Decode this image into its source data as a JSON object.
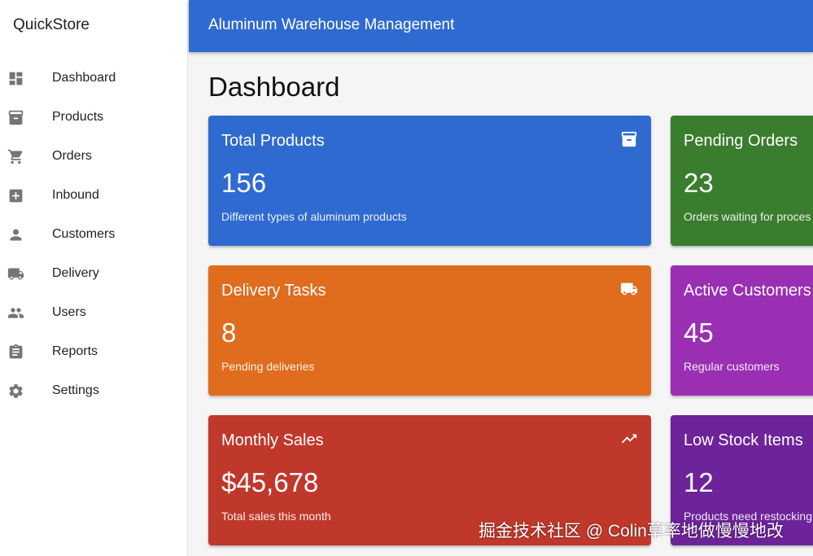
{
  "sidebar": {
    "brand": "QuickStore",
    "items": [
      {
        "label": "Dashboard",
        "icon": "dashboard-icon"
      },
      {
        "label": "Products",
        "icon": "archive-box-icon"
      },
      {
        "label": "Orders",
        "icon": "shopping-cart-icon"
      },
      {
        "label": "Inbound",
        "icon": "add-box-icon"
      },
      {
        "label": "Customers",
        "icon": "person-icon"
      },
      {
        "label": "Delivery",
        "icon": "truck-icon"
      },
      {
        "label": "Users",
        "icon": "people-icon"
      },
      {
        "label": "Reports",
        "icon": "clipboard-icon"
      },
      {
        "label": "Settings",
        "icon": "gear-icon"
      }
    ]
  },
  "appbar": {
    "title": "Aluminum Warehouse Management",
    "color": "#2f6ad0"
  },
  "page": {
    "title": "Dashboard"
  },
  "cards": [
    {
      "title": "Total Products",
      "value": "156",
      "desc": "Different types of aluminum products",
      "color": "#2f6ad0",
      "icon": "archive-box-icon"
    },
    {
      "title": "Pending Orders",
      "value": "23",
      "desc": "Orders waiting for proces",
      "color": "#3a7d2e"
    },
    {
      "title": "Delivery Tasks",
      "value": "8",
      "desc": "Pending deliveries",
      "color": "#e06c1e",
      "icon": "truck-icon"
    },
    {
      "title": "Active Customers",
      "value": "45",
      "desc": "Regular customers",
      "color": "#9a2fb3"
    },
    {
      "title": "Monthly Sales",
      "value": "$45,678",
      "desc": "Total sales this month",
      "color": "#c0382b",
      "icon": "trending-up-icon"
    },
    {
      "title": "Low Stock Items",
      "value": "12",
      "desc": "Products need restocking",
      "color": "#6d2399"
    }
  ],
  "watermark": "掘金技术社区 @ Colin草率地做慢慢地改"
}
